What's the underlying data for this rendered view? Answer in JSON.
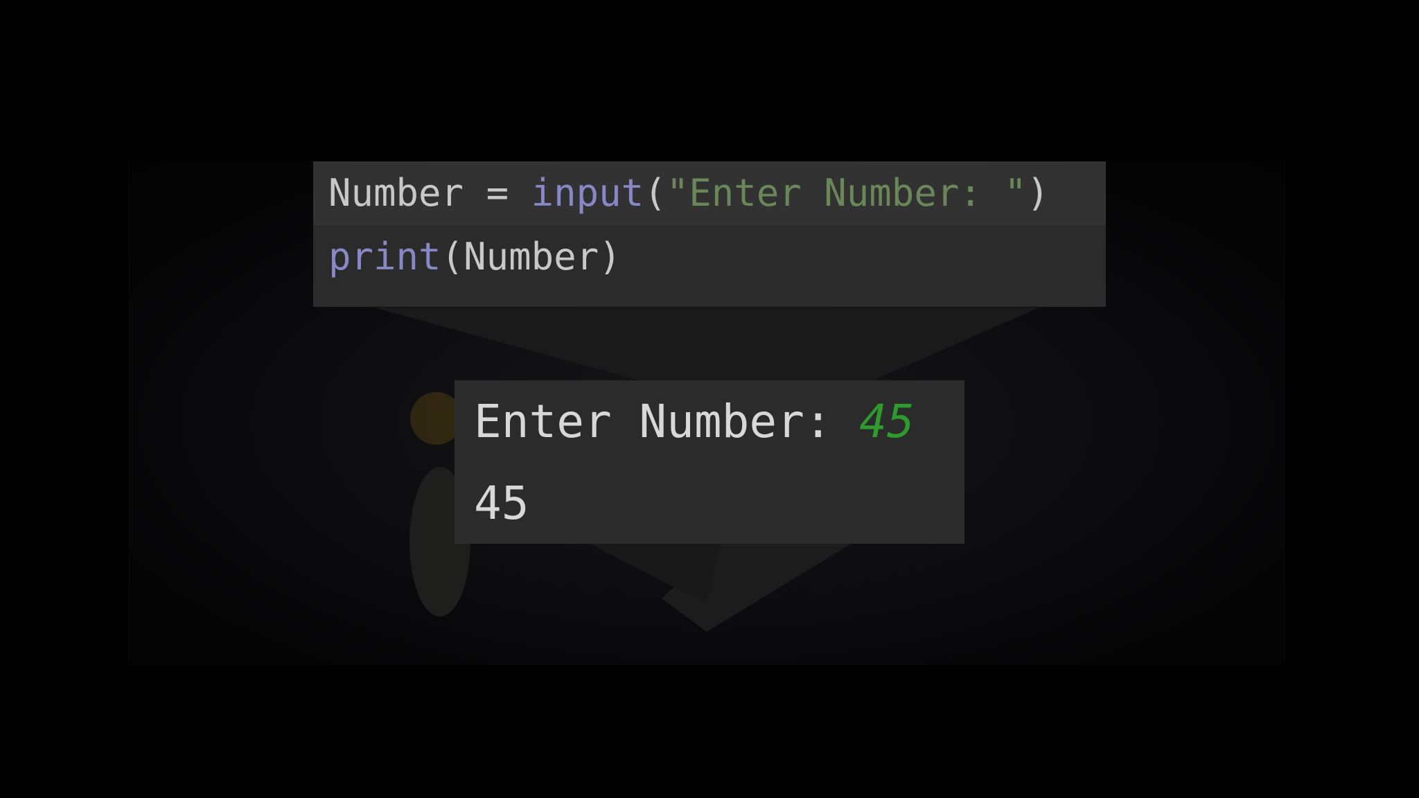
{
  "code": {
    "line1": {
      "variable": "Number",
      "operator": " = ",
      "function": "input",
      "open_paren": "(",
      "string": "\"Enter Number: \"",
      "close_paren": ")"
    },
    "line2": {
      "function": "print",
      "open_paren": "(",
      "argument": "Number",
      "close_paren": ")"
    }
  },
  "console": {
    "prompt": "Enter Number: ",
    "user_input": "45",
    "output": "45"
  },
  "colors": {
    "background": "#000000",
    "panel": "#2b2b2b",
    "current_line": "#323232",
    "builtin_function": "#8888c6",
    "string": "#6a8759",
    "user_input": "#2d9b2d",
    "text": "#c8c8c8"
  }
}
